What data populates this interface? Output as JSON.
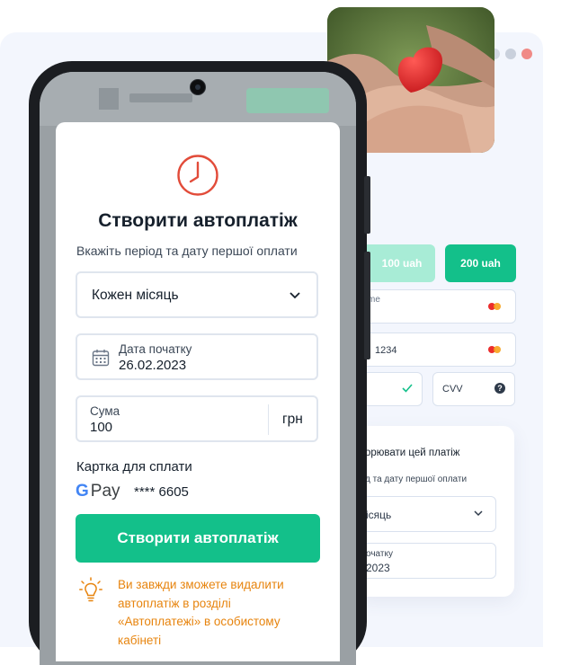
{
  "modal": {
    "title": "Створити автоплатіж",
    "subtitle": "Вкажіть період та дату першої оплати",
    "period": "Кожен місяць",
    "start_date_label": "Дата початку",
    "start_date_value": "26.02.2023",
    "amount_label": "Сума",
    "amount_value": "100",
    "currency": "грн",
    "card_label": "Картка для сплати",
    "gpay_letter": "G",
    "gpay_text": "Pay",
    "masked_card": "**** 6605",
    "submit": "Створити автоплатіж",
    "hint": "Ви завжди зможете видалити автоплатіж в розділі «Автоплатежі» в особистому кабінеті"
  },
  "background": {
    "amount_100": "100 uah",
    "amount_200": "200 uah",
    "name_placeholder": "me",
    "card_partial": "1234",
    "cvv": "CVV",
    "cvv_help": "?",
    "panel_title": "орювати цей платіж",
    "panel_subtitle": "д та дату першої оплати",
    "panel_period": "ісяць",
    "panel_date_label": "очатку",
    "panel_date_value": "2023"
  },
  "colors": {
    "accent_green": "#13c08a",
    "clock_red": "#e24c3a",
    "hint_orange": "#e7840e",
    "window_dots": [
      "#d3d9e4",
      "#c9d0dc",
      "#f08a86"
    ]
  }
}
